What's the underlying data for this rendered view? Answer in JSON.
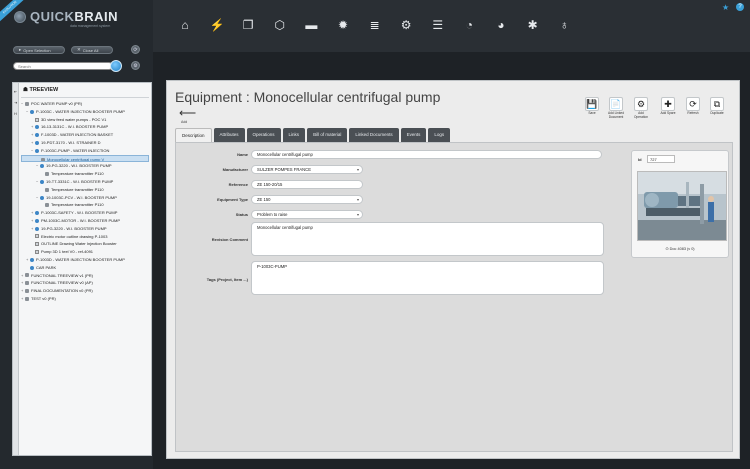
{
  "app": {
    "ribbon": "EVOLUTION",
    "logo_light": "QUICK",
    "logo_bold": "BRAIN",
    "logo_sub": "data management system"
  },
  "sidebar": {
    "open_selection": "Open Selection",
    "close_all": "Close All",
    "search_placeholder": "Search",
    "tree_title": "TREEVIEW",
    "tree_items": [
      {
        "label": "POC WATER PUMP v0 (PR)",
        "depth": 0,
        "node": "gray",
        "expander": "−"
      },
      {
        "label": "P-1003C - WATER INJECTION BOOSTER PUMP",
        "depth": 1,
        "node": "blue",
        "expander": "−"
      },
      {
        "label": "3D view feed water pumps - POC V1",
        "depth": 2,
        "node": "doc",
        "expander": ""
      },
      {
        "label": "16-13-3131C - W.I. BOOSTER PUMP",
        "depth": 2,
        "node": "blue",
        "expander": "+"
      },
      {
        "label": "F-1003D - WATER INJECTION BASKET",
        "depth": 2,
        "node": "blue",
        "expander": "+"
      },
      {
        "label": "19-PDT-3170 - W.I. STRAINER D",
        "depth": 2,
        "node": "blue",
        "expander": "+"
      },
      {
        "label": "P-1003C-PUMP - WATER INJECTION",
        "depth": 2,
        "node": "blue",
        "expander": "−"
      },
      {
        "label": "Monocellular centrifugal pump V",
        "depth": 3,
        "node": "gray",
        "expander": "",
        "selected": true
      },
      {
        "label": "19-PG-3220 - W.I. BOOSTER PUMP",
        "depth": 3,
        "node": "blue",
        "expander": "−"
      },
      {
        "label": "Temperature transmitter P110",
        "depth": 4,
        "node": "gray",
        "expander": ""
      },
      {
        "label": "19-TT-3331C - W.I. BOOSTER PUMP",
        "depth": 3,
        "node": "blue",
        "expander": "−"
      },
      {
        "label": "Temperature transmitter P110",
        "depth": 4,
        "node": "gray",
        "expander": ""
      },
      {
        "label": "19-1003C-PCV - W.I. BOOSTER PUMP",
        "depth": 3,
        "node": "blue",
        "expander": "−"
      },
      {
        "label": "Temperature transmitter P110",
        "depth": 4,
        "node": "gray",
        "expander": ""
      },
      {
        "label": "P-1003C-SAFETY - W.I. BOOSTER PUMP",
        "depth": 2,
        "node": "blue",
        "expander": "+"
      },
      {
        "label": "PM-1003C-MOTOR - W.I. BOOSTER PUMP",
        "depth": 2,
        "node": "blue",
        "expander": "+"
      },
      {
        "label": "19-PG-3220 - W.I. BOOSTER PUMP",
        "depth": 2,
        "node": "blue",
        "expander": "+"
      },
      {
        "label": "Electric motor outline drawing P-1003",
        "depth": 2,
        "node": "doc",
        "expander": ""
      },
      {
        "label": "OUTLINE Drawing Water Injection Booster",
        "depth": 2,
        "node": "doc",
        "expander": ""
      },
      {
        "label": "Pump 3D 1 teel V0 - ref-4091",
        "depth": 2,
        "node": "doc",
        "expander": ""
      },
      {
        "label": "P-1003D - WATER INJECTION BOOSTER PUMP",
        "depth": 1,
        "node": "blue",
        "expander": "+"
      },
      {
        "label": "CAR PARK",
        "depth": 1,
        "node": "blue",
        "expander": ""
      },
      {
        "label": "FUNCTIONAL TREEVIEW v1 (PR)",
        "depth": 0,
        "node": "gray",
        "expander": "+"
      },
      {
        "label": "FUNCTIONAL TREEVIEW v0 (AP)",
        "depth": 0,
        "node": "gray",
        "expander": "+"
      },
      {
        "label": "FINAL DOCUMENTATION v0 (PR)",
        "depth": 0,
        "node": "gray",
        "expander": "+"
      },
      {
        "label": "TEST v0 (PR)",
        "depth": 0,
        "node": "gray",
        "expander": "+"
      }
    ]
  },
  "toolbar_icons": [
    "home-icon",
    "bolt-icon",
    "documents-icon",
    "cube-icon",
    "folder-icon",
    "gear-icon",
    "database-icon",
    "cogs-icon",
    "database-gear-icon",
    "timer-icon",
    "pie-icon",
    "tools-icon",
    "lightbulb-icon"
  ],
  "main": {
    "title": "Equipment : Monocellular centrifugal pump",
    "back_label": "Add",
    "actions": [
      {
        "label": "Save",
        "icon": "💾"
      },
      {
        "label": "Add Linked Document",
        "icon": "📄"
      },
      {
        "label": "Add Operation",
        "icon": "⚙"
      },
      {
        "label": "Add Spare",
        "icon": "✚"
      },
      {
        "label": "Refresh",
        "icon": "⟳"
      },
      {
        "label": "Duplicate",
        "icon": "⧉"
      }
    ],
    "tabs": [
      "Description",
      "Attributes",
      "Operations",
      "Links",
      "Bill of material",
      "Linked Documents",
      "Events",
      "Logs"
    ],
    "form": {
      "name_label": "Name",
      "name_value": "Monocellular centrifugal pump",
      "manufacturer_label": "Manufacturer",
      "manufacturer_value": "SULZER POMPES FRANCE",
      "reference_label": "Reference",
      "reference_value": "ZE 150-20/15",
      "equipment_type_label": "Equipment Type",
      "equipment_type_value": "ZE 150",
      "status_label": "Status",
      "status_value": "Problem to raise",
      "revision_label": "Revision Comment",
      "revision_value": "Monocellular centrifugal pump",
      "tags_label": "Tags (Project, Item ...)",
      "tags_value": "P-1003C-PUMP"
    },
    "card": {
      "id_label": "Id",
      "id_value": "727",
      "doc_link": "Doc 4083 (v 0)"
    }
  }
}
